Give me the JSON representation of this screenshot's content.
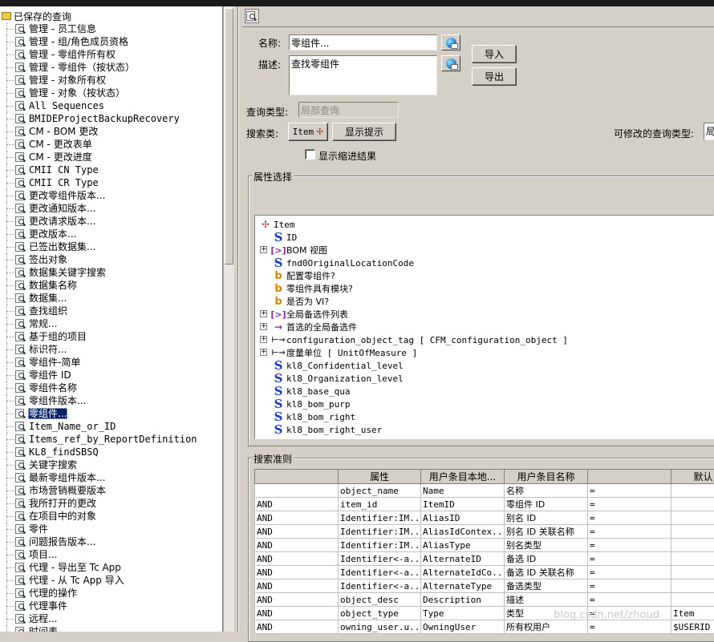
{
  "left_tree": {
    "root_label": "已保存的查询",
    "items": [
      "管理 - 员工信息",
      "管理 - 组/角色成员资格",
      "管理 - 零组件所有权",
      "管理 - 零组件（按状态）",
      "管理 - 对象所有权",
      "管理 - 对象（按状态）",
      "All Sequences",
      "BMIDEProjectBackupRecovery",
      "CM - BOM 更改",
      "CM - 更改表单",
      "CM - 更改进度",
      "CMII CN Type",
      "CMII CR Type",
      "更改零组件版本...",
      "更改通知版本...",
      "更改请求版本...",
      "更改版本...",
      "已签出数据集...",
      "签出对象",
      "数据集关键字搜索",
      "数据集名称",
      "数据集...",
      "查找组织",
      "常规...",
      "基于组的项目",
      "标识符...",
      "零组件-简单",
      "零组件 ID",
      "零组件名称",
      "零组件版本...",
      "零组件...",
      "Item_Name_or_ID",
      "Items_ref_by_ReportDefinition",
      "KL8_findSBSQ",
      "关键字搜索",
      "最新零组件版本...",
      "市场营销概要版本",
      "我所打开的更改",
      "在项目中的对象",
      "零件",
      "问题报告版本...",
      "项目...",
      "代理 - 导出至 Tc App",
      "代理 - 从 Tc App 导入",
      "代理的操作",
      "代理事件",
      "远程...",
      "时间表..."
    ],
    "selected_index": 30
  },
  "form": {
    "name_label": "名称:",
    "name_value": "零组件...",
    "desc_label": "描述:",
    "desc_value": "查找零组件",
    "import_button": "导入",
    "export_button": "导出",
    "query_type_label": "查询类型:",
    "query_type_value": "局部查询",
    "search_class_label": "搜索类:",
    "search_class_value": "Item",
    "show_hint_button": "显示提示",
    "modifiable_label": "可修改的查询类型:",
    "modifiable_value": "局",
    "show_indented_label": "显示缩进结果"
  },
  "attr_section": {
    "title": "属性选择",
    "rows": [
      {
        "icon": "item-icon",
        "label": "Item",
        "expander": "",
        "level": 0
      },
      {
        "icon": "string-icon",
        "label": "ID",
        "expander": "",
        "level": 1
      },
      {
        "icon": "bracket-icon",
        "label": "BOM 视图",
        "expander": "+",
        "level": 1
      },
      {
        "icon": "string-icon",
        "label": "fnd0OriginalLocationCode",
        "expander": "",
        "level": 1
      },
      {
        "icon": "boolean-icon",
        "label": "配置零组件?",
        "expander": "",
        "level": 1
      },
      {
        "icon": "boolean-icon",
        "label": "零组件具有模块?",
        "expander": "",
        "level": 1
      },
      {
        "icon": "boolean-icon",
        "label": "是否为 VI?",
        "expander": "",
        "level": 1
      },
      {
        "icon": "bracket-icon",
        "label": "全局备选件列表",
        "expander": "+",
        "level": 1
      },
      {
        "icon": "arrow-icon",
        "label": "首选的全局备选件",
        "expander": "+",
        "level": 1
      },
      {
        "icon": "reference-icon",
        "label": "configuration_object_tag [ CFM_configuration_object ]",
        "expander": "+",
        "level": 1
      },
      {
        "icon": "reference-icon",
        "label": "度量单位 [ UnitOfMeasure ]",
        "expander": "+",
        "level": 1
      },
      {
        "icon": "string-icon",
        "label": "kl8_Confidential_level",
        "expander": "",
        "level": 1
      },
      {
        "icon": "string-icon",
        "label": "kl8_Organization_level",
        "expander": "",
        "level": 1
      },
      {
        "icon": "string-icon",
        "label": "kl8_base_qua",
        "expander": "",
        "level": 1
      },
      {
        "icon": "string-icon",
        "label": "kl8_bom_purp",
        "expander": "",
        "level": 1
      },
      {
        "icon": "string-icon",
        "label": "kl8_bom_right",
        "expander": "",
        "level": 1
      },
      {
        "icon": "string-icon",
        "label": "kl8_bom_right_user",
        "expander": "",
        "level": 1
      }
    ]
  },
  "criteria": {
    "title": "搜索准则",
    "columns": [
      "",
      "属性",
      "用户条目本地...",
      "用户条目名称",
      "",
      "默认"
    ],
    "rows": [
      [
        "",
        "object_name",
        "Name",
        "名称",
        "=",
        ""
      ],
      [
        "AND",
        "item_id",
        "ItemID",
        "零组件 ID",
        "=",
        ""
      ],
      [
        "AND",
        "Identifier:IM...",
        "AliasID",
        "别名 ID",
        "=",
        ""
      ],
      [
        "AND",
        "Identifier:IM...",
        "AliasIdContex...",
        "别名 ID 关联名称",
        "=",
        ""
      ],
      [
        "AND",
        "Identifier:IM...",
        "AliasType",
        "别名类型",
        "=",
        ""
      ],
      [
        "AND",
        "Identifier<-a...",
        "AlternateID",
        "备选 ID",
        "=",
        ""
      ],
      [
        "AND",
        "Identifier<-a...",
        "AlternateIdCo...",
        "备选 ID 关联名称",
        "=",
        ""
      ],
      [
        "AND",
        "Identifier<-a...",
        "AlternateType",
        "备选类型",
        "=",
        ""
      ],
      [
        "AND",
        "object_desc",
        "Description",
        "描述",
        "=",
        ""
      ],
      [
        "AND",
        "object_type",
        "Type",
        "类型",
        "=",
        "Item"
      ],
      [
        "AND",
        "owning_user.u...",
        "OwningUser",
        "所有权用户",
        "=",
        "$USERID"
      ]
    ]
  },
  "watermark": "blog.csdn.net/zhoud"
}
